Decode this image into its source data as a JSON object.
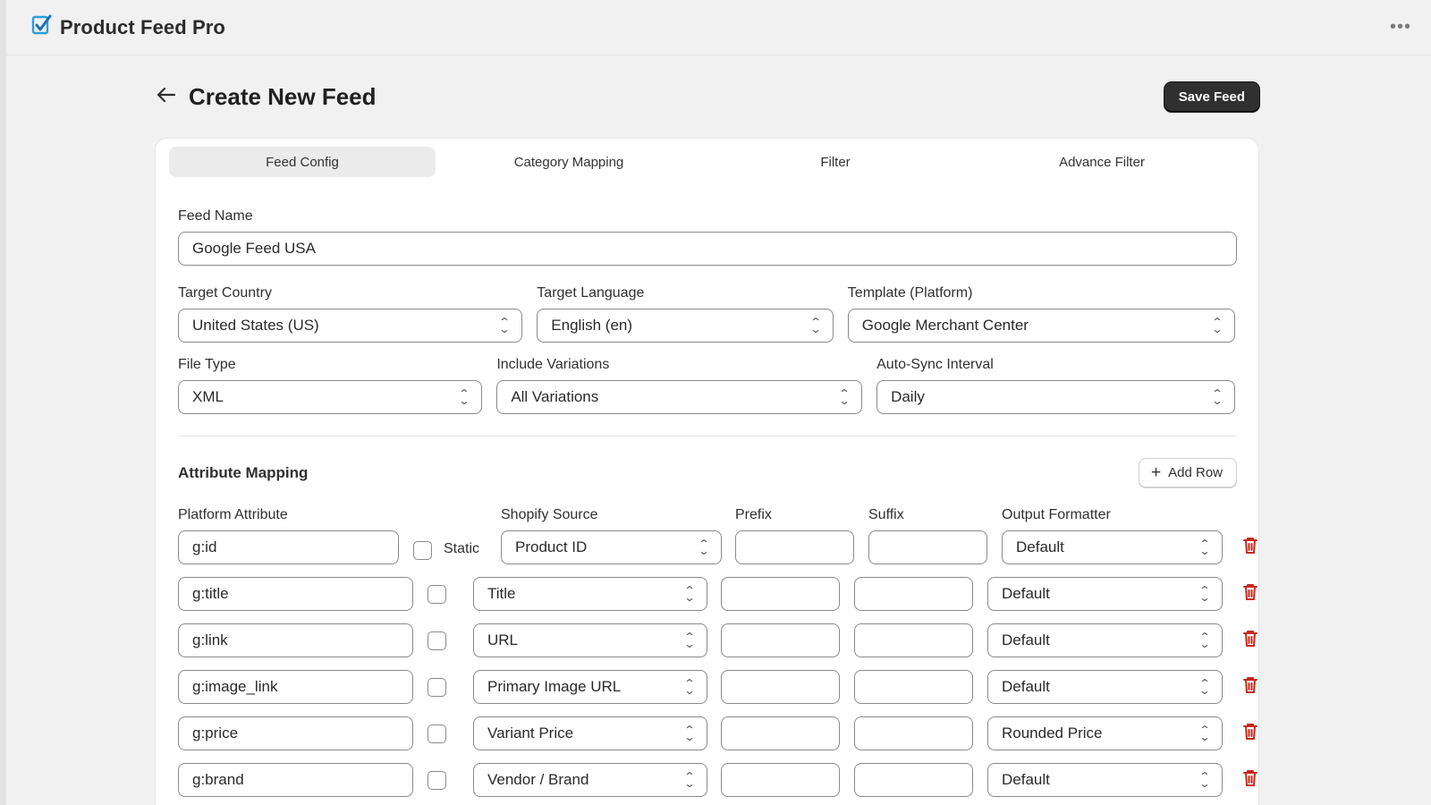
{
  "app": {
    "title": "Product Feed Pro",
    "menu_icon": "ellipsis-icon"
  },
  "header": {
    "title": "Create New Feed",
    "save_label": "Save Feed"
  },
  "tabs": [
    {
      "label": "Feed Config",
      "active": true
    },
    {
      "label": "Category Mapping",
      "active": false
    },
    {
      "label": "Filter",
      "active": false
    },
    {
      "label": "Advance Filter",
      "active": false
    }
  ],
  "form": {
    "feed_name": {
      "label": "Feed Name",
      "value": "Google Feed USA"
    },
    "target_country": {
      "label": "Target Country",
      "value": "United States (US)"
    },
    "target_language": {
      "label": "Target Language",
      "value": "English (en)"
    },
    "template": {
      "label": "Template (Platform)",
      "value": "Google Merchant Center"
    },
    "file_type": {
      "label": "File Type",
      "value": "XML"
    },
    "include_variations": {
      "label": "Include Variations",
      "value": "All Variations"
    },
    "auto_sync": {
      "label": "Auto-Sync Interval",
      "value": "Daily"
    }
  },
  "attribute_mapping": {
    "title": "Attribute Mapping",
    "add_row_label": "Add Row",
    "columns": {
      "platform_attribute": "Platform Attribute",
      "shopify_source": "Shopify Source",
      "prefix": "Prefix",
      "suffix": "Suffix",
      "output_formatter": "Output Formatter"
    },
    "static_label": "Static",
    "rows": [
      {
        "attribute": "g:id",
        "source": "Product ID",
        "prefix": "",
        "suffix": "",
        "formatter": "Default"
      },
      {
        "attribute": "g:title",
        "source": "Title",
        "prefix": "",
        "suffix": "",
        "formatter": "Default"
      },
      {
        "attribute": "g:link",
        "source": "URL",
        "prefix": "",
        "suffix": "",
        "formatter": "Default"
      },
      {
        "attribute": "g:image_link",
        "source": "Primary Image URL",
        "prefix": "",
        "suffix": "",
        "formatter": "Default"
      },
      {
        "attribute": "g:price",
        "source": "Variant Price",
        "prefix": "",
        "suffix": "",
        "formatter": "Rounded Price"
      },
      {
        "attribute": "g:brand",
        "source": "Vendor / Brand",
        "prefix": "",
        "suffix": "",
        "formatter": "Default"
      }
    ]
  },
  "colors": {
    "accent": "#303030",
    "danger": "#c5281c",
    "logo": "#2c9fd9"
  }
}
